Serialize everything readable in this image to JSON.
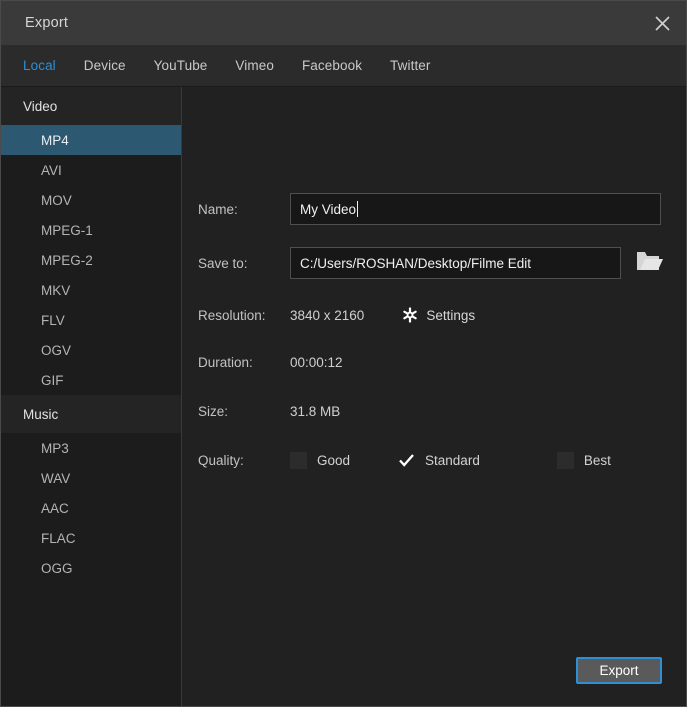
{
  "window": {
    "title": "Export",
    "close_icon": "close-icon"
  },
  "tabs": [
    {
      "label": "Local",
      "active": true
    },
    {
      "label": "Device",
      "active": false
    },
    {
      "label": "YouTube",
      "active": false
    },
    {
      "label": "Vimeo",
      "active": false
    },
    {
      "label": "Facebook",
      "active": false
    },
    {
      "label": "Twitter",
      "active": false
    }
  ],
  "sidebar": {
    "groups": [
      {
        "header": "Video",
        "items": [
          {
            "label": "MP4",
            "selected": true
          },
          {
            "label": "AVI",
            "selected": false
          },
          {
            "label": "MOV",
            "selected": false
          },
          {
            "label": "MPEG-1",
            "selected": false
          },
          {
            "label": "MPEG-2",
            "selected": false
          },
          {
            "label": "MKV",
            "selected": false
          },
          {
            "label": "FLV",
            "selected": false
          },
          {
            "label": "OGV",
            "selected": false
          },
          {
            "label": "GIF",
            "selected": false
          }
        ]
      },
      {
        "header": "Music",
        "items": [
          {
            "label": "MP3",
            "selected": false
          },
          {
            "label": "WAV",
            "selected": false
          },
          {
            "label": "AAC",
            "selected": false
          },
          {
            "label": "FLAC",
            "selected": false
          },
          {
            "label": "OGG",
            "selected": false
          }
        ]
      }
    ]
  },
  "form": {
    "name": {
      "label": "Name:",
      "value": "My Video",
      "placeholder": "Name"
    },
    "save_to": {
      "label": "Save to:",
      "value": "C:/Users/ROSHAN/Desktop/Filme Edit",
      "placeholder": "Save to",
      "browse_icon": "folder-icon"
    },
    "resolution": {
      "label": "Resolution:",
      "value": "3840 x 2160",
      "settings_label": "Settings",
      "settings_icon": "gear-icon"
    },
    "duration": {
      "label": "Duration:",
      "value": "00:00:12"
    },
    "size": {
      "label": "Size:",
      "value": "31.8 MB"
    },
    "quality": {
      "label": "Quality:",
      "options": [
        {
          "label": "Good",
          "checked": false
        },
        {
          "label": "Standard",
          "checked": true
        },
        {
          "label": "Best",
          "checked": false
        }
      ]
    }
  },
  "footer": {
    "export_label": "Export"
  },
  "colors": {
    "accent": "#2f8fd4",
    "selection": "#2c5871",
    "window_bg": "#1e1e1e",
    "panel_bg": "#212121",
    "sidebar_bg": "#1c1c1c",
    "titlebar_bg": "#3a3a3a"
  }
}
